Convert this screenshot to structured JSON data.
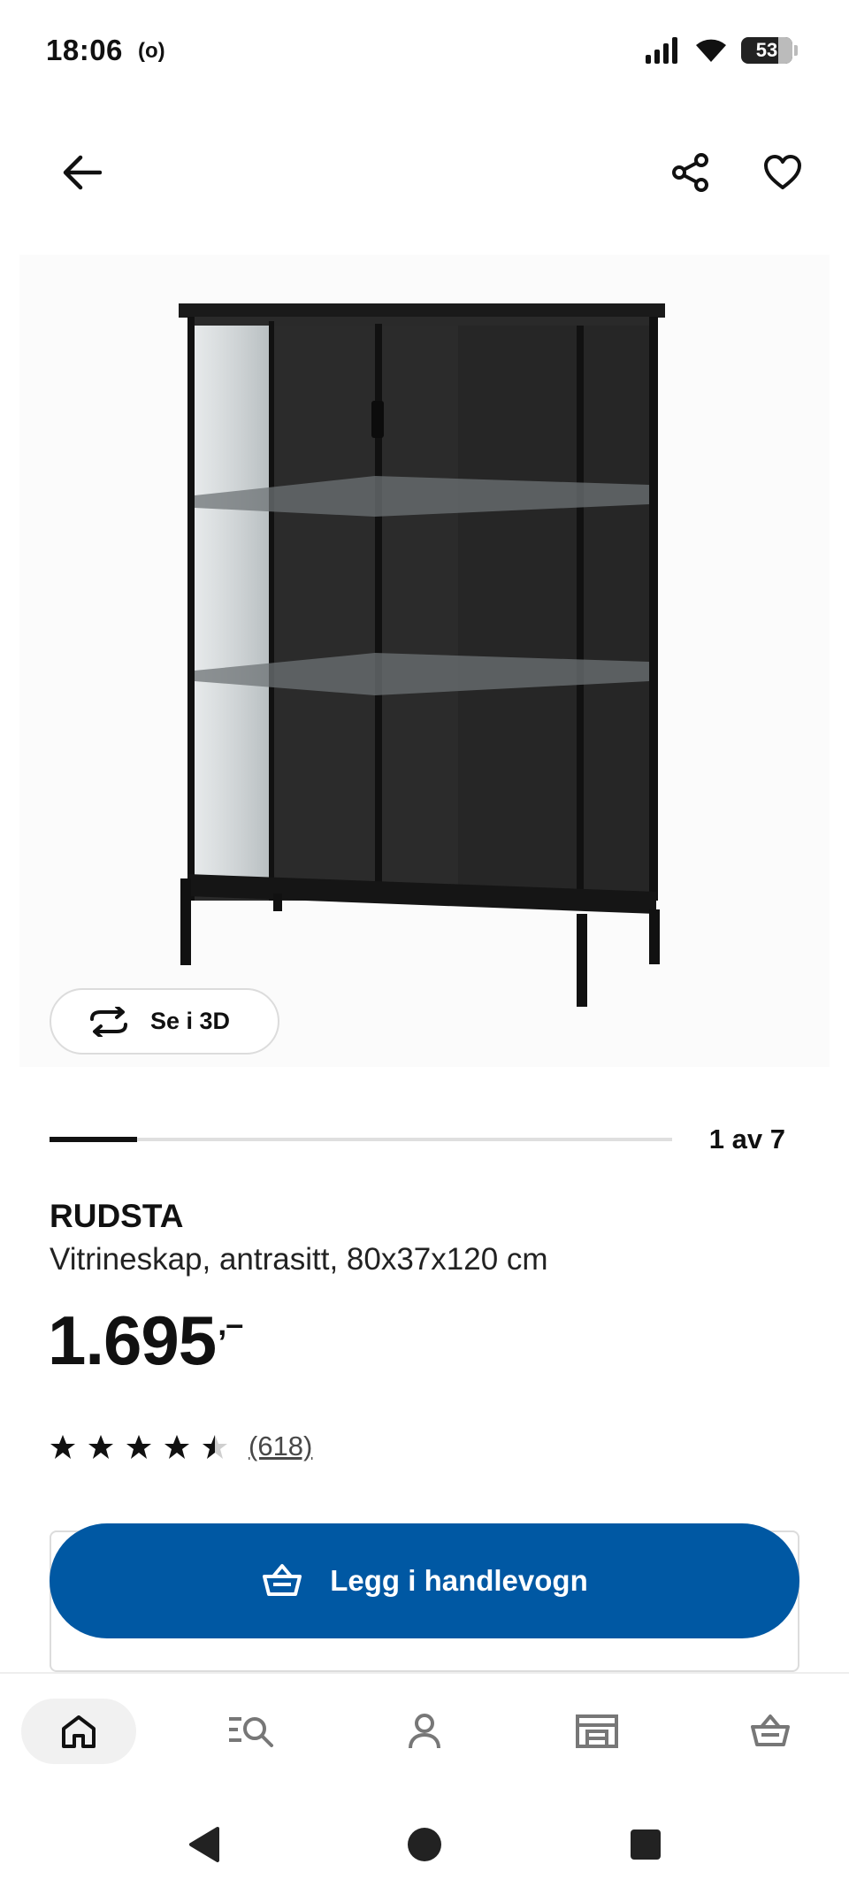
{
  "status_bar": {
    "time": "18:06",
    "radio_indicator": "(o)",
    "battery_percent": "53",
    "icons": [
      "signal-icon",
      "wifi-icon",
      "battery-icon"
    ]
  },
  "toolbar": {
    "icons": [
      "back-arrow-icon",
      "share-icon",
      "heart-icon"
    ]
  },
  "gallery": {
    "view_3d_label": "Se i 3D",
    "position_text": "1 av 7",
    "progress": 0.14
  },
  "product": {
    "name": "RUDSTA",
    "description": "Vitrineskap, antrasitt, 80x37x120 cm",
    "price_main": "1.695",
    "price_suffix": ",–",
    "rating_stars": 4.5,
    "rating_count": "(618)"
  },
  "cart": {
    "add_label": "Legg i handlevogn"
  },
  "bottom_nav": {
    "items": [
      "home-icon",
      "search-list-icon",
      "profile-icon",
      "store-icon",
      "basket-icon"
    ],
    "active": "home-icon"
  },
  "colors": {
    "ikea_blue": "#0058a3",
    "text": "#111111"
  }
}
